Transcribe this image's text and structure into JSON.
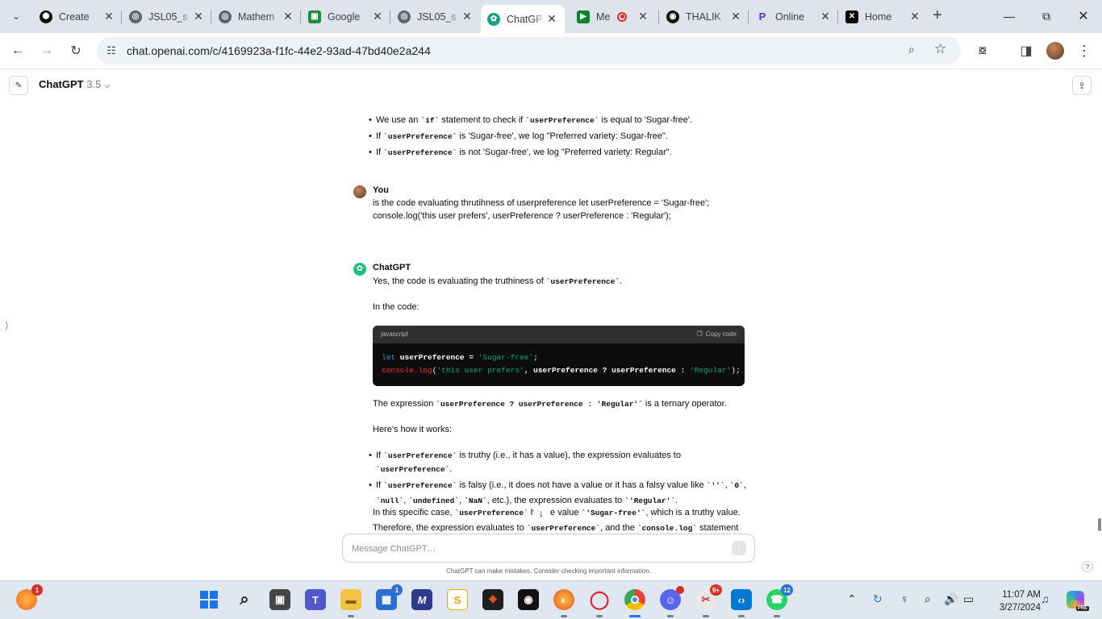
{
  "browser": {
    "tabs": [
      {
        "label": "Create",
        "icon": "codepen-icon"
      },
      {
        "label": "JSL05_s",
        "icon": "globe-icon"
      },
      {
        "label": "Mathem",
        "icon": "globe-icon"
      },
      {
        "label": "Google",
        "icon": "google-classroom-icon"
      },
      {
        "label": "JSL05_s",
        "icon": "globe-icon"
      },
      {
        "label": "ChatGP",
        "icon": "openai-icon",
        "active": true
      },
      {
        "label": "Me",
        "icon": "google-meet-icon"
      },
      {
        "label": "THALIK",
        "icon": "github-icon"
      },
      {
        "label": "Online",
        "icon": "p-logo-icon"
      },
      {
        "label": "Home",
        "icon": "x-logo-icon"
      }
    ],
    "url": "chat.openai.com/c/4169923a-f1fc-44e2-93ad-47bd40e2a244"
  },
  "chatgpt": {
    "model_name": "ChatGPT",
    "model_version": "3.5",
    "previous_bullets": [
      {
        "pre": "We use an ",
        "code": "`if`",
        "post": " statement to check if ",
        "code2": "`userPreference`",
        "post2": " is equal to 'Sugar-free'."
      },
      {
        "pre": "If ",
        "code": "`userPreference`",
        "post": " is 'Sugar-free', we log \"Preferred variety: Sugar-free\".",
        "code2": "",
        "post2": ""
      },
      {
        "pre": "If ",
        "code": "`userPreference`",
        "post": " is not 'Sugar-free', we log \"Preferred variety: Regular\".",
        "code2": "",
        "post2": ""
      }
    ],
    "user_message": {
      "author": "You",
      "line1": "is the code evaluating thrutihness of userpreference  let userPreference = 'Sugar-free';",
      "line2": "console.log('this user prefers', userPreference ? userPreference : 'Regular');"
    },
    "assistant_message": {
      "author": "ChatGPT",
      "intro_pre": "Yes, the code is evaluating the truthiness of ",
      "intro_code": "`userPreference`",
      "intro_post": ".",
      "in_the_code": "In the code:",
      "code_block": {
        "language": "javascript",
        "copy_label": "Copy code",
        "line1": {
          "kw": "let",
          "var": " userPreference ",
          "op": "= ",
          "str": "'Sugar-free'",
          "end": ";"
        },
        "line2": {
          "fn": "console.log",
          "open": "(",
          "str1": "'this user prefers'",
          "mid": ", userPreference ? userPreference : ",
          "str2": "'Regular'",
          "end": ");"
        }
      },
      "expr_pre": "The expression ",
      "expr_code": "`userPreference ? userPreference : 'Regular'`",
      "expr_post": " is a ternary operator.",
      "how": "Here's how it works:",
      "bullet1": {
        "pre": "If ",
        "code": "`userPreference`",
        "mid": " is truthy (i.e., it has a value), the expression evaluates to ",
        "code2": "`userPreference`",
        "post": "."
      },
      "bullet2": {
        "pre": "If ",
        "code": "`userPreference`",
        "mid": " is falsy (i.e., it does not have a value or it has a falsy value like ",
        "c1": "`''`",
        "s1": ", ",
        "c2": "`0`",
        "s2": ",",
        "c3": "`null`",
        "s3": ", ",
        "c4": "`undefined`",
        "s4": ", ",
        "c5": "`NaN`",
        "s5": ", etc.), the expression evaluates to ",
        "c6": "`'Regular'`",
        "post": "."
      },
      "final_line1": {
        "pre": "In this specific case, ",
        "code": "`userPreference`",
        "mid": " ha",
        "mid2": "e value ",
        "code2": "`'Sugar-free'`",
        "post": ", which is a truthy value."
      },
      "final_line2": {
        "pre": "Therefore, the expression evaluates to ",
        "code": "`userPreference`",
        "mid": ", and the ",
        "code2": "`console.log`",
        "post": " statement will"
      }
    },
    "composer_placeholder": "Message ChatGPT…",
    "disclaimer": "ChatGPT can make mistakes. Consider checking important information.",
    "help": "?"
  },
  "taskbar": {
    "badges": {
      "brave": "1",
      "store": "1",
      "grabber": "9+",
      "whatsapp": "12"
    },
    "clock_time": "11:07 AM",
    "clock_date": "3/27/2024",
    "copilot_label": "PRE"
  },
  "colors": {
    "chatgpt_green": "#19c37d",
    "tab_strip": "#dfe3eb",
    "omnibox": "#eef1f6",
    "code_bg": "#0d0d0d",
    "taskbar": "#dfe7f1"
  }
}
